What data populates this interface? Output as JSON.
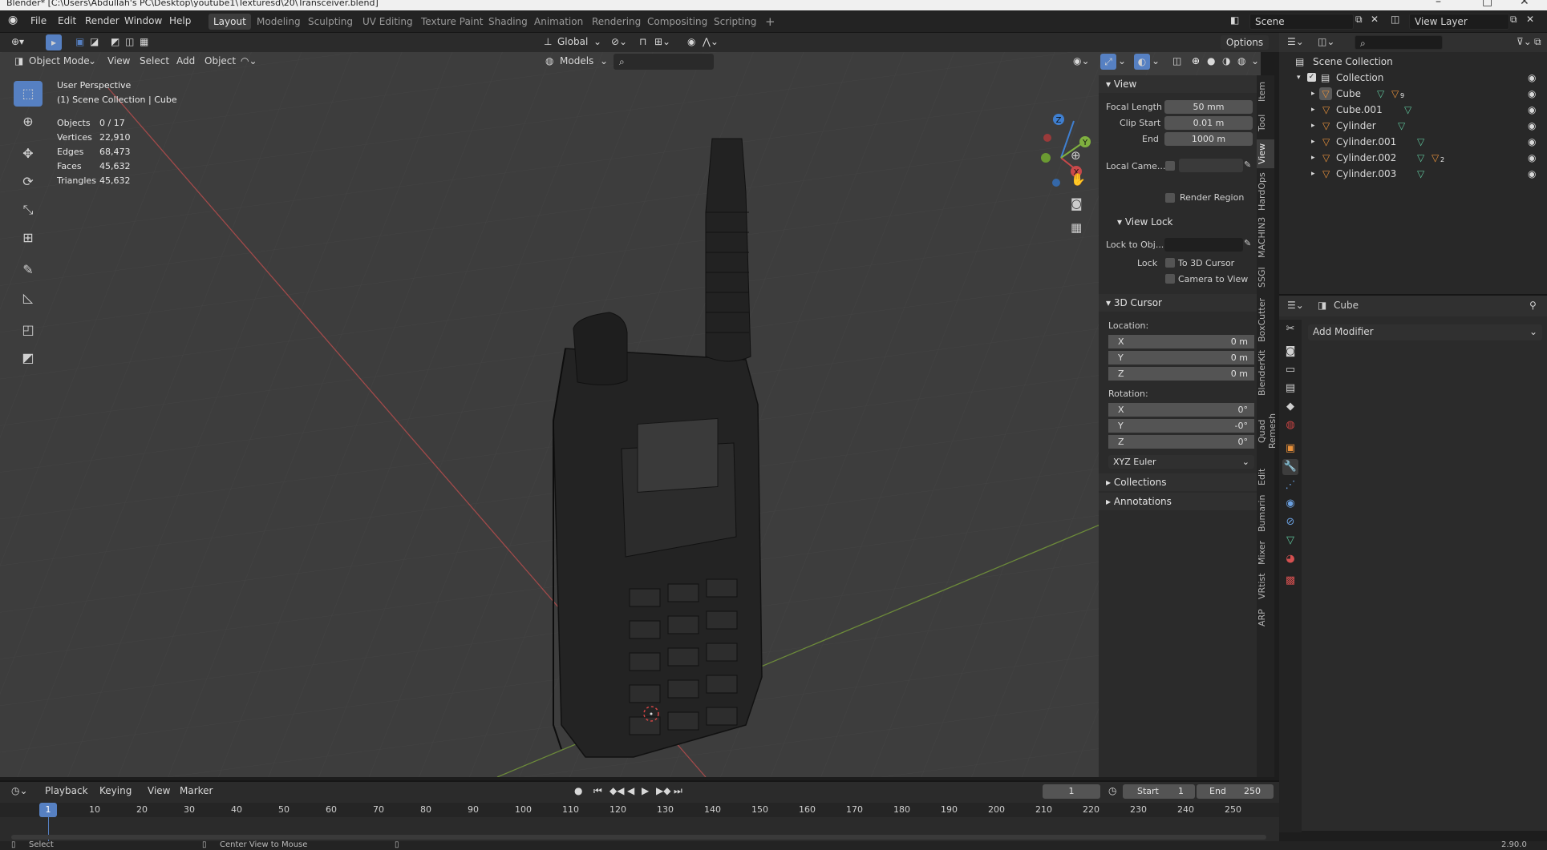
{
  "window": {
    "title": "Blender* [C:\\Users\\Abdullah's PC\\Desktop\\youtube1\\Texturesd\\20\\Transceiver.blend]",
    "version": "2.90.0"
  },
  "menu": [
    "File",
    "Edit",
    "Render",
    "Window",
    "Help"
  ],
  "workspaces": [
    {
      "label": "Layout",
      "active": true
    },
    {
      "label": "Modeling"
    },
    {
      "label": "Sculpting"
    },
    {
      "label": "UV Editing"
    },
    {
      "label": "Texture Paint"
    },
    {
      "label": "Shading"
    },
    {
      "label": "Animation"
    },
    {
      "label": "Rendering"
    },
    {
      "label": "Compositing"
    },
    {
      "label": "Scripting"
    }
  ],
  "scene": {
    "name": "Scene",
    "view_layer": "View Layer"
  },
  "tool_header": {
    "orientation": "Global",
    "options": "Options"
  },
  "viewport_header": {
    "mode": "Object Mode",
    "menus": [
      "View",
      "Select",
      "Add",
      "Object"
    ],
    "models_dropdown": "Models"
  },
  "overlay": {
    "perspective": "User Perspective",
    "collection": "(1) Scene Collection | Cube",
    "stats": [
      {
        "label": "Objects",
        "value": "0 / 17"
      },
      {
        "label": "Vertices",
        "value": "22,910"
      },
      {
        "label": "Edges",
        "value": "68,473"
      },
      {
        "label": "Faces",
        "value": "45,632"
      },
      {
        "label": "Triangles",
        "value": "45,632"
      }
    ]
  },
  "npanel": {
    "view_title": "View",
    "focal_length_label": "Focal Length",
    "focal_length": "50 mm",
    "clip_start_label": "Clip Start",
    "clip_start": "0.01 m",
    "end_label": "End",
    "end": "1000 m",
    "local_camera_label": "Local Came...",
    "render_region": "Render Region",
    "view_lock_title": "View Lock",
    "lock_to_obj_label": "Lock to Obj...",
    "lock_label": "Lock",
    "to_3d_cursor": "To 3D Cursor",
    "camera_to_view": "Camera to View",
    "cursor_title": "3D Cursor",
    "location_label": "Location:",
    "location": [
      {
        "axis": "X",
        "value": "0 m"
      },
      {
        "axis": "Y",
        "value": "0 m"
      },
      {
        "axis": "Z",
        "value": "0 m"
      }
    ],
    "rotation_label": "Rotation:",
    "rotation": [
      {
        "axis": "X",
        "value": "0°"
      },
      {
        "axis": "Y",
        "value": "-0°"
      },
      {
        "axis": "Z",
        "value": "0°"
      }
    ],
    "rotation_mode": "XYZ Euler",
    "collections": "Collections",
    "annotations": "Annotations"
  },
  "sidebar_tabs": [
    "Item",
    "Tool",
    "View",
    "HardOps",
    "MACHIN3",
    "SSGI",
    "BoxCutter",
    "BlenderKit",
    "Quad Remesh",
    "Edit",
    "Bumarin",
    "Mixer",
    "VRtist",
    "ARP"
  ],
  "outliner": {
    "root": "Scene Collection",
    "collection": "Collection",
    "objects": [
      {
        "name": "Cube",
        "badge": "9"
      },
      {
        "name": "Cube.001"
      },
      {
        "name": "Cylinder"
      },
      {
        "name": "Cylinder.001"
      },
      {
        "name": "Cylinder.002",
        "badge": "2"
      },
      {
        "name": "Cylinder.003"
      }
    ]
  },
  "properties": {
    "object_name": "Cube",
    "add_modifier": "Add Modifier"
  },
  "timeline": {
    "menus": [
      "Playback",
      "Keying",
      "View",
      "Marker"
    ],
    "current_frame": "1",
    "start_label": "Start",
    "start": "1",
    "end_label": "End",
    "end": "250",
    "ticks": [
      "10",
      "20",
      "30",
      "40",
      "50",
      "60",
      "70",
      "80",
      "90",
      "100",
      "110",
      "120",
      "130",
      "140",
      "150",
      "160",
      "170",
      "180",
      "190",
      "200",
      "210",
      "220",
      "230",
      "240",
      "250"
    ],
    "cursor_frame": "1"
  },
  "statusbar": {
    "left": "Select",
    "middle": "Center View to Mouse"
  },
  "colors": {
    "accent": "#5680c2",
    "viewport_bg": "#3d3d3d",
    "header_bg": "#303030",
    "panel_bg": "#2b2b2b",
    "x_axis": "#c9494a",
    "y_axis": "#7fb03f",
    "z_axis": "#3f7fd0",
    "object_orange": "#e8913b",
    "mesh_green": "#5ec29a"
  }
}
